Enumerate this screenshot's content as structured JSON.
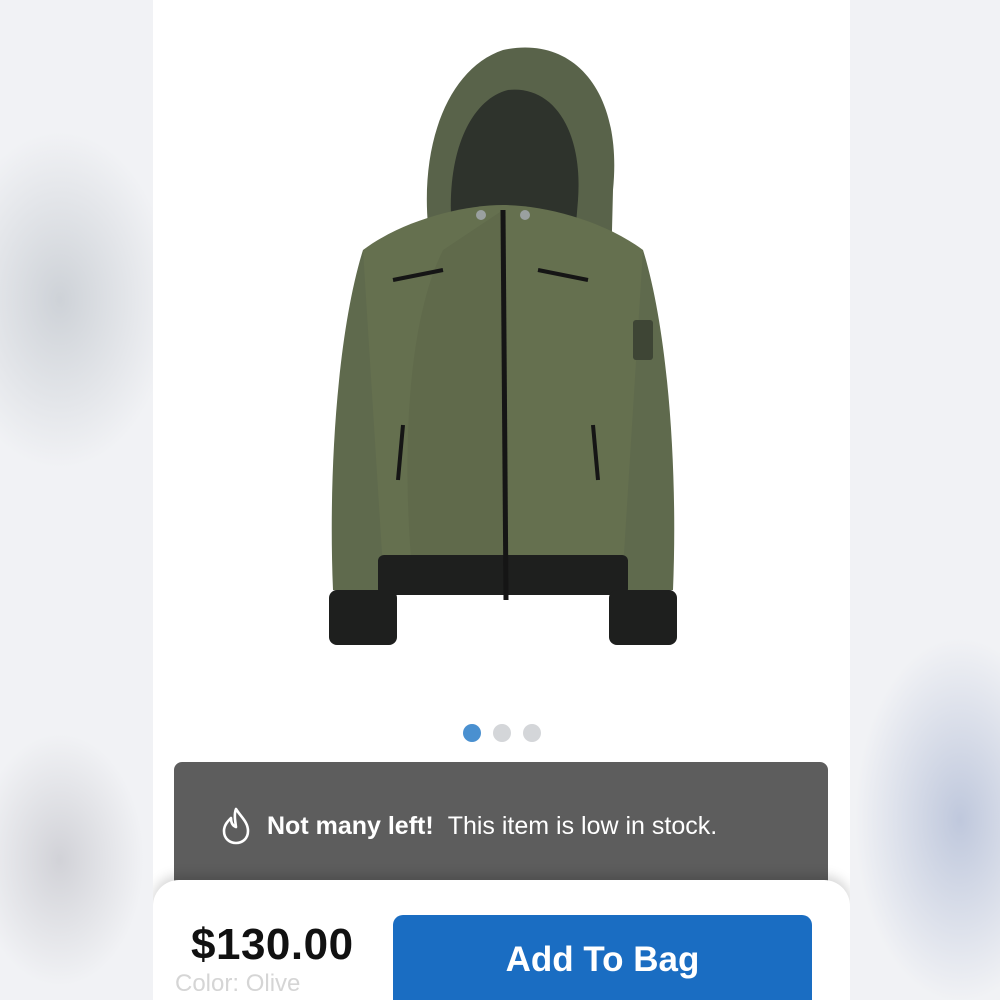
{
  "product": {
    "image_alt": "olive-hooded-bomber-jacket",
    "carousel": {
      "count": 3,
      "active_index": 0
    }
  },
  "stock_banner": {
    "icon": "flame-icon",
    "headline": "Not many left!",
    "message": "This item is low in stock."
  },
  "purchase": {
    "price": "$130.00",
    "color_label": "Color: Olive",
    "add_to_bag_label": "Add To Bag"
  },
  "colors": {
    "accent": "#1a6dc2",
    "dot_active": "#4a90d0",
    "banner_bg": "#5d5d5d"
  }
}
